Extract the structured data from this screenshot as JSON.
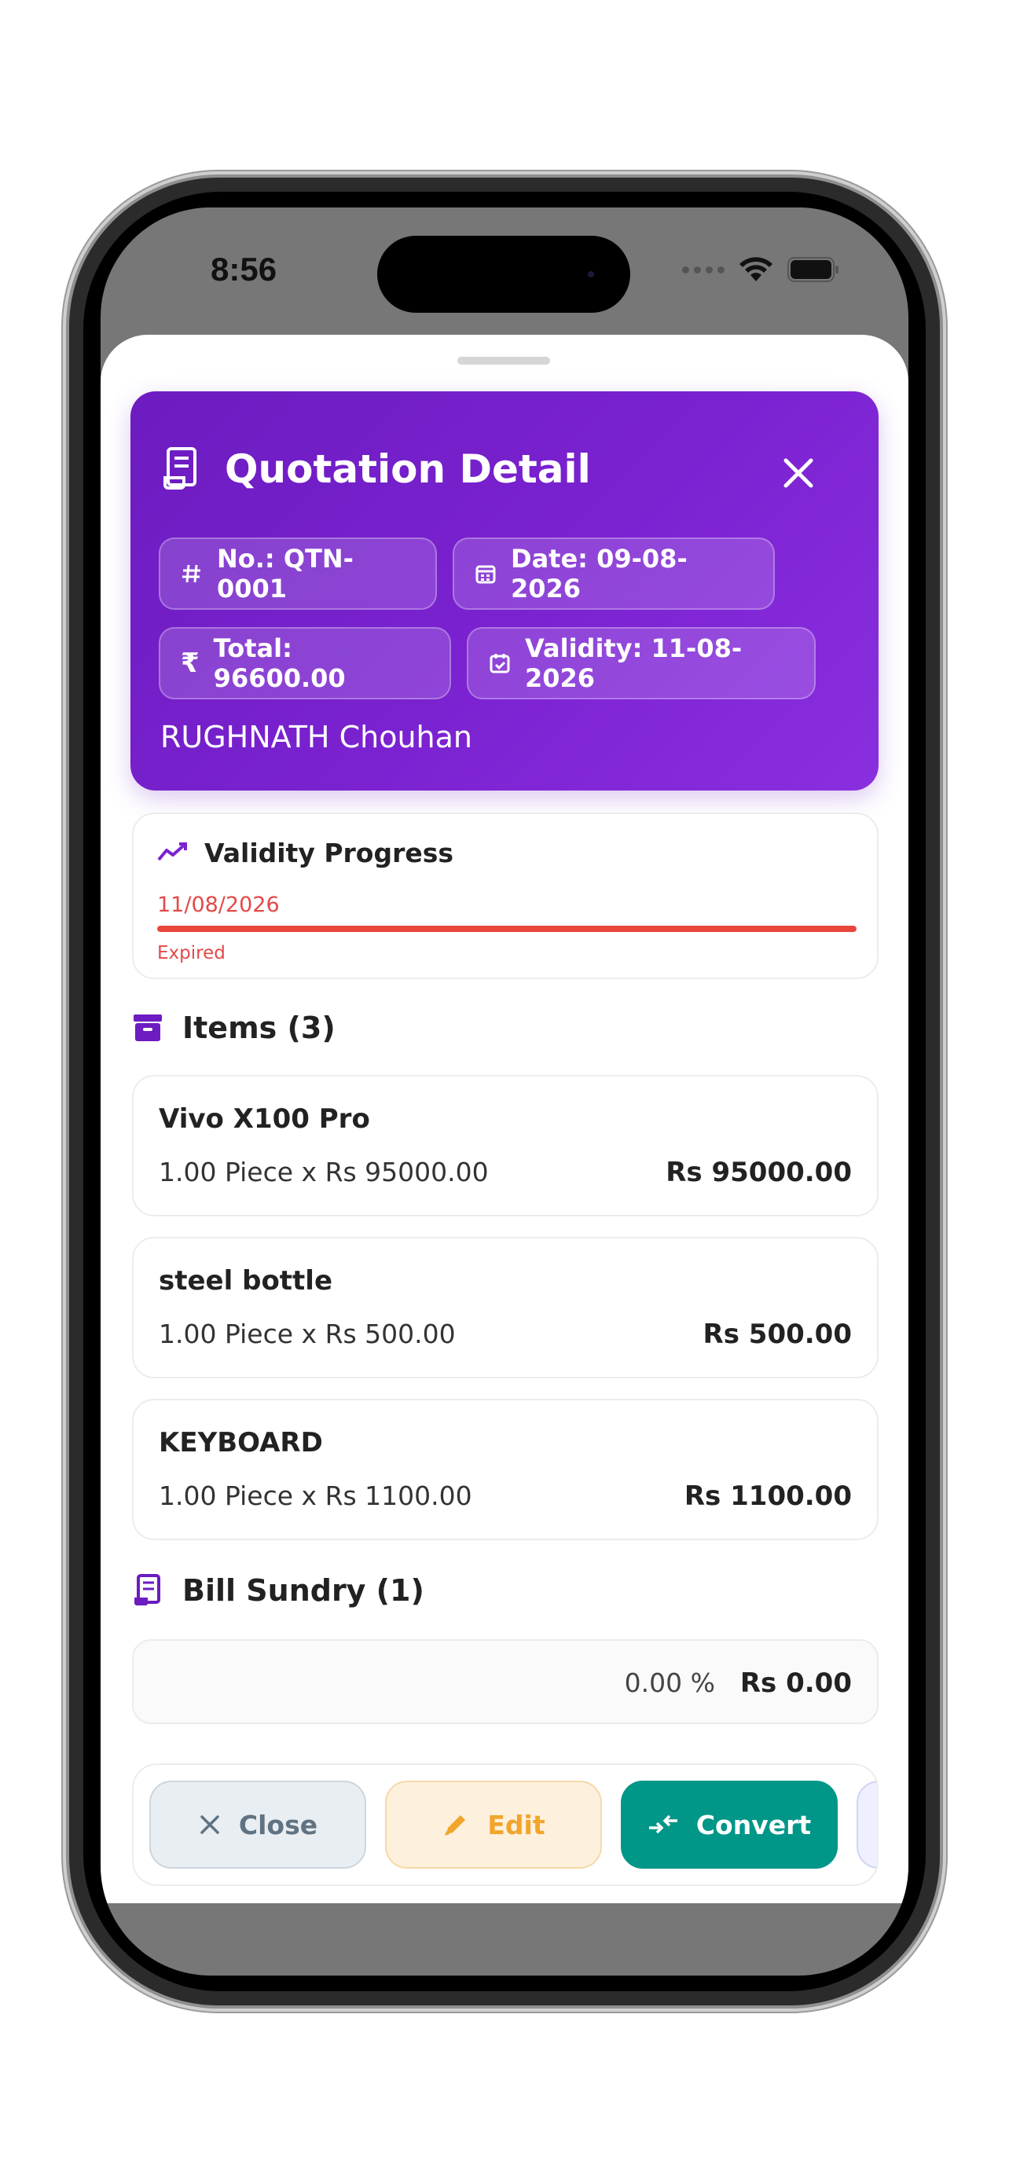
{
  "status_bar": {
    "time": "8:56"
  },
  "header": {
    "title": "Quotation Detail",
    "chips": {
      "number": "No.: QTN-0001",
      "date": "Date: 09-08-2026",
      "total": "Total: 96600.00",
      "validity": "Validity: 11-08-2026"
    },
    "customer": "RUGHNATH Chouhan"
  },
  "validity": {
    "title": "Validity Progress",
    "date": "11/08/2026",
    "status": "Expired",
    "progress_percent": 100
  },
  "items_section": {
    "title": "Items (3)",
    "items": [
      {
        "name": "Vivo X100 Pro",
        "qty": "1.00 Piece x Rs 95000.00",
        "amount": "Rs 95000.00"
      },
      {
        "name": "steel bottle",
        "qty": "1.00 Piece x Rs 500.00",
        "amount": "Rs 500.00"
      },
      {
        "name": "KEYBOARD",
        "qty": "1.00 Piece x Rs 1100.00",
        "amount": "Rs 1100.00"
      }
    ]
  },
  "sundry_section": {
    "title": "Bill Sundry (1)",
    "rows": [
      {
        "percent": "0.00 %",
        "amount": "Rs 0.00"
      }
    ]
  },
  "actions": {
    "close": "Close",
    "edit": "Edit",
    "convert": "Convert"
  },
  "colors": {
    "header_gradient_start": "#6c1cc0",
    "header_gradient_end": "#8a2fe0",
    "expired": "#e8453c",
    "convert": "#009688",
    "edit": "#f1a52b"
  }
}
